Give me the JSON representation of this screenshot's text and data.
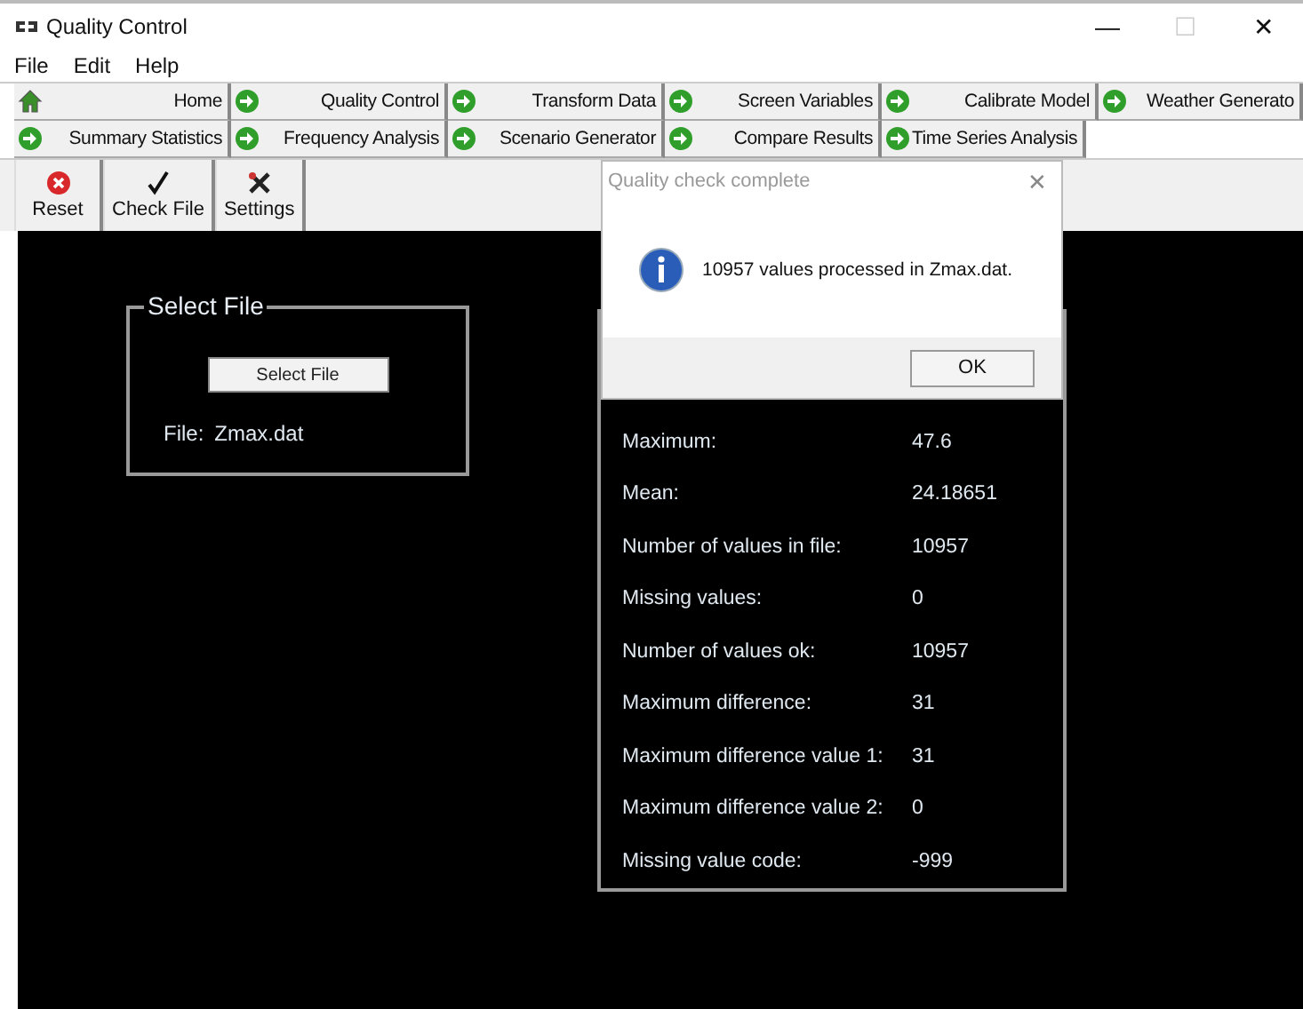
{
  "window": {
    "title": "Quality Control",
    "controls": [
      {
        "glyph": "—",
        "disabled": false
      },
      {
        "glyph": "☐",
        "disabled": true
      },
      {
        "glyph": "✕",
        "disabled": false
      }
    ]
  },
  "menu": [
    "File",
    "Edit",
    "Help"
  ],
  "nav_rows": [
    [
      {
        "label": "Home",
        "kind": "home"
      },
      {
        "label": "Quality Control",
        "kind": "arrow"
      },
      {
        "label": "Transform Data",
        "kind": "arrow"
      },
      {
        "label": "Screen Variables",
        "kind": "arrow"
      },
      {
        "label": "Calibrate Model",
        "kind": "arrow"
      },
      {
        "label": "Weather Generato",
        "kind": "arrow"
      }
    ],
    [
      {
        "label": "Summary Statistics",
        "kind": "arrow"
      },
      {
        "label": "Frequency Analysis",
        "kind": "arrow"
      },
      {
        "label": "Scenario Generator",
        "kind": "arrow"
      },
      {
        "label": "Compare Results",
        "kind": "arrow"
      },
      {
        "label": "Time Series Analysis",
        "kind": "arrow"
      }
    ]
  ],
  "toolbar": [
    {
      "label": "Reset",
      "kind": "reset"
    },
    {
      "label": "Check File",
      "kind": "check"
    },
    {
      "label": "Settings",
      "kind": "settings"
    }
  ],
  "select_file": {
    "title": "Select File",
    "button": "Select File",
    "file_label": "File:",
    "file_name": "Zmax.dat"
  },
  "results": [
    {
      "label": "Maximum:",
      "value": "47.6"
    },
    {
      "label": "Mean:",
      "value": "24.18651"
    },
    {
      "label": "Number of values in file:",
      "value": "10957"
    },
    {
      "label": "Missing values:",
      "value": "0"
    },
    {
      "label": "Number of values ok:",
      "value": "10957"
    },
    {
      "label": "Maximum difference:",
      "value": "31"
    },
    {
      "label": "Maximum difference value 1:",
      "value": "31"
    },
    {
      "label": "Maximum difference value 2:",
      "value": "0"
    },
    {
      "label": "Missing value code:",
      "value": "-999"
    }
  ],
  "dialog": {
    "title": "Quality check complete",
    "close": "✕",
    "message": "10957 values processed in Zmax.dat.",
    "button": "OK"
  }
}
